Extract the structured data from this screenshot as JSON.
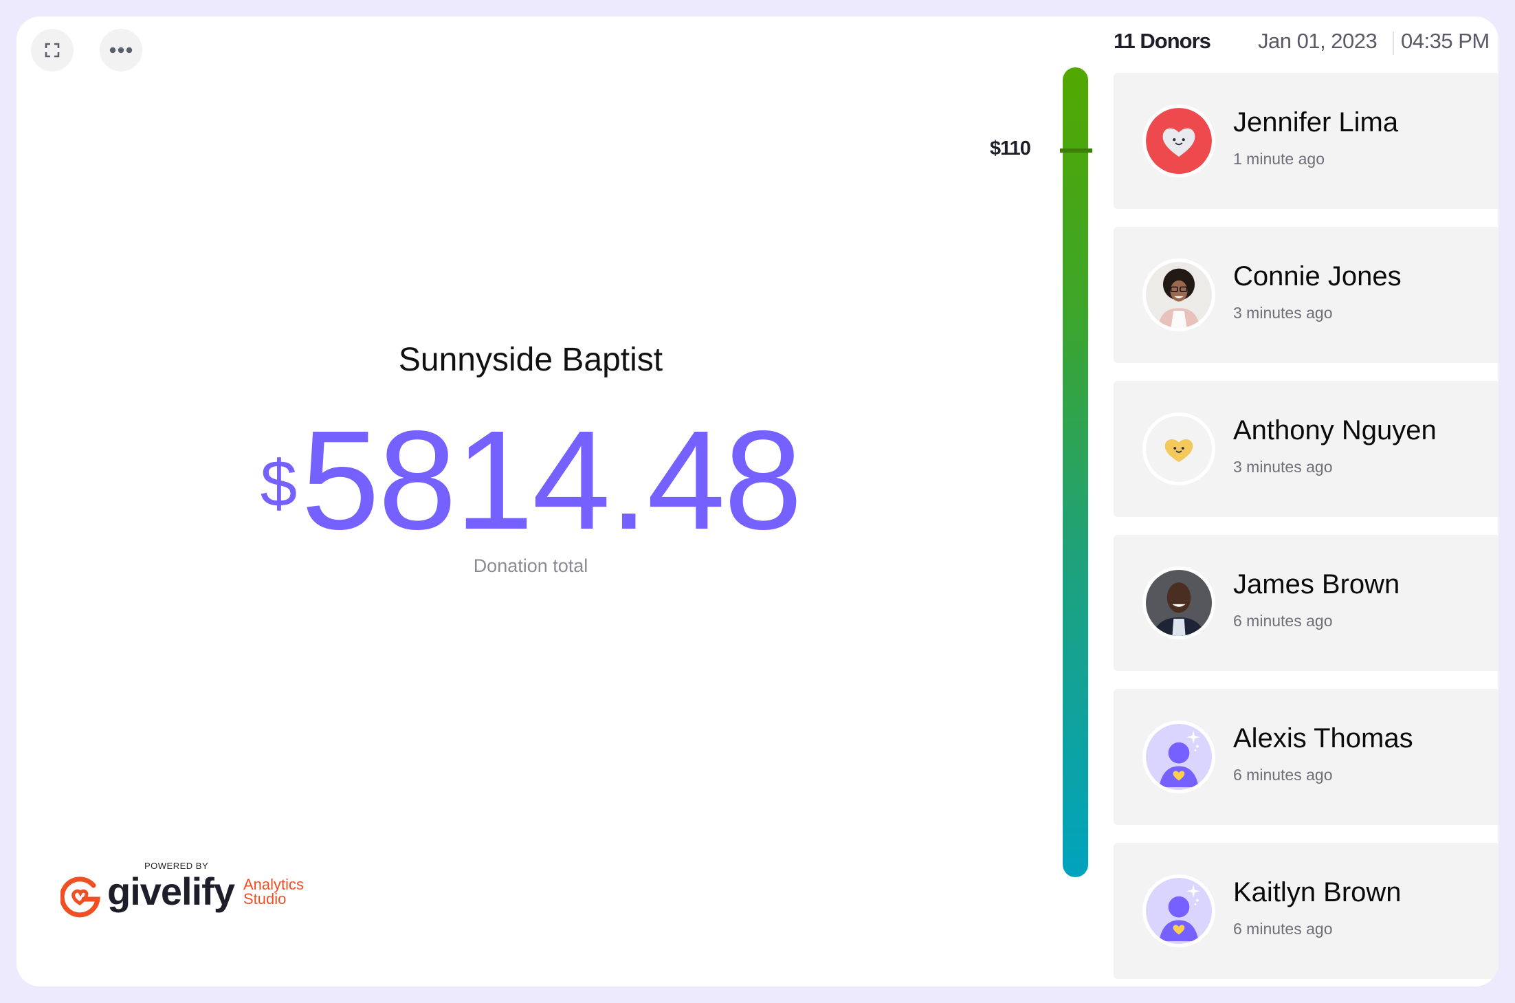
{
  "toolbar": {
    "fullscreen_icon": "fullscreen-icon",
    "more_icon": "more-horizontal-icon"
  },
  "campaign": {
    "organization": "Sunnyside Baptist",
    "currency_symbol": "$",
    "total": "5814.48",
    "total_label": "Donation total"
  },
  "branding": {
    "powered_by": "POWERED BY",
    "wordmark": "givelify",
    "product_line1": "Analytics",
    "product_line2": "Studio",
    "brand_color": "#F04E23"
  },
  "gauge": {
    "marker_label": "$110",
    "marker_fraction_from_top": 0.103,
    "fill_fraction": 1.0,
    "color_top": "#52A800",
    "color_bottom": "#00A3BE"
  },
  "header": {
    "donor_count": "11 Donors",
    "date": "Jan 01, 2023",
    "time": "04:35 PM"
  },
  "donors": [
    {
      "name": "Jennifer Lima",
      "time": "1 minute ago",
      "avatar": "red-heart-avatar-icon"
    },
    {
      "name": "Connie Jones",
      "time": "3 minutes ago",
      "avatar": "photo-avatar"
    },
    {
      "name": "Anthony Nguyen",
      "time": "3 minutes ago",
      "avatar": "yellow-heart-avatar-icon"
    },
    {
      "name": "James Brown",
      "time": "6 minutes ago",
      "avatar": "photo-avatar"
    },
    {
      "name": "Alexis Thomas",
      "time": "6 minutes ago",
      "avatar": "default-person-avatar-icon"
    },
    {
      "name": "Kaitlyn Brown",
      "time": "6 minutes ago",
      "avatar": "default-person-avatar-icon"
    }
  ],
  "colors": {
    "accent": "#7461FF",
    "frame": "#ECEAFC",
    "card": "#F3F3F3"
  }
}
